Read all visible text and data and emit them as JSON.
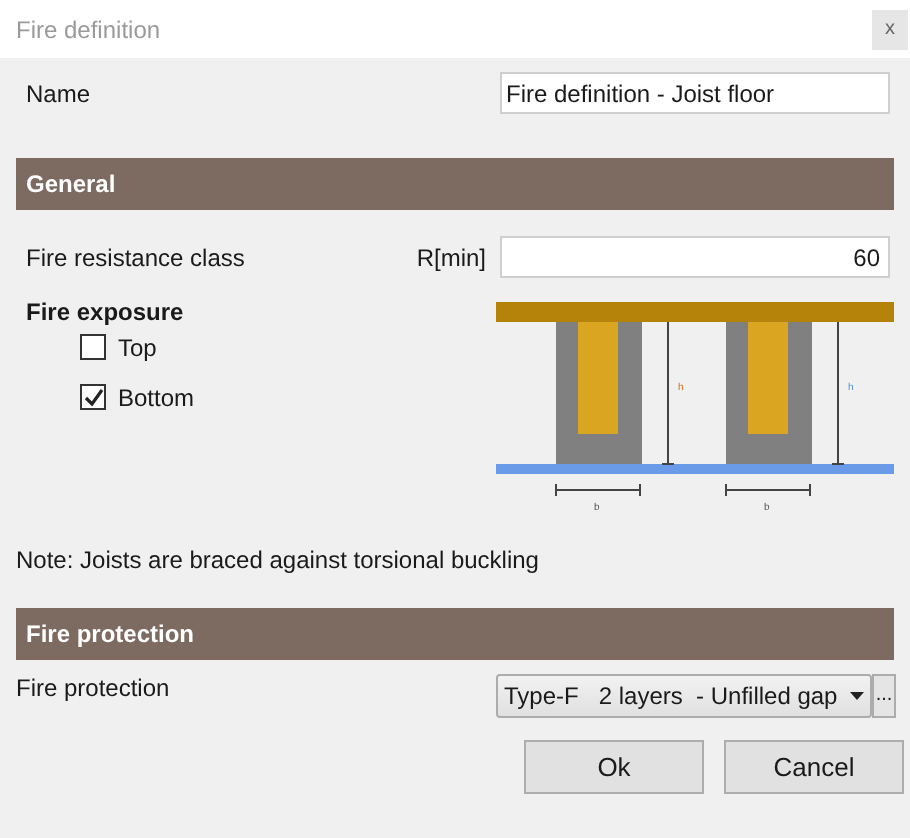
{
  "window": {
    "title": "Fire definition",
    "close": "x"
  },
  "name": {
    "label": "Name",
    "value": "Fire definition - Joist floor"
  },
  "general": {
    "title": "General",
    "resistance": {
      "label": "Fire resistance class",
      "unit": "R[min]",
      "value": "60"
    },
    "exposure": {
      "title": "Fire exposure",
      "options": [
        {
          "label": "Top",
          "checked": false
        },
        {
          "label": "Bottom",
          "checked": true
        }
      ]
    },
    "diagram": {
      "height_labels": [
        "h",
        "h"
      ],
      "width_labels": [
        "b",
        "b"
      ]
    },
    "note": "Note: Joists are braced against torsional buckling"
  },
  "fire_protection": {
    "title": "Fire protection",
    "label": "Fire protection",
    "value": "Type-F   2 layers  - Unfilled gap",
    "more": "..."
  },
  "buttons": [
    "Ok",
    "Cancel"
  ]
}
